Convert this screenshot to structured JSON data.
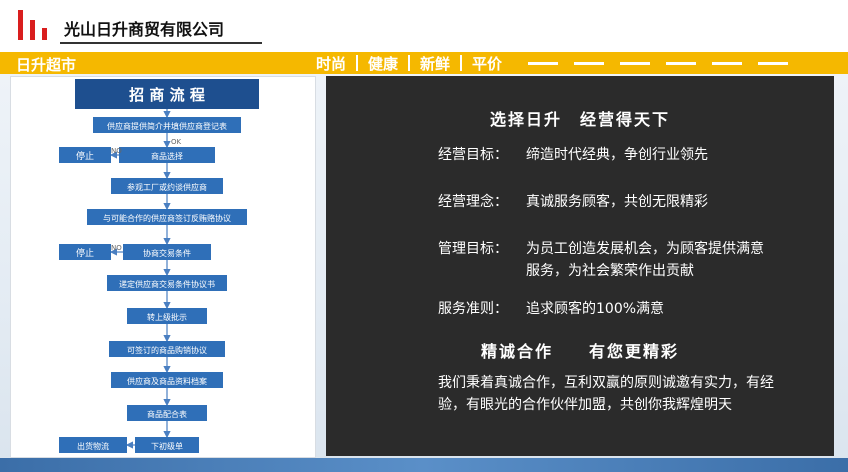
{
  "header": {
    "company": "光山日升商贸有限公司"
  },
  "bar": {
    "title": "日升超市",
    "nav": [
      "时尚",
      "健康",
      "新鲜",
      "平价"
    ]
  },
  "flow": {
    "title": "招 商 流 程",
    "steps": [
      "供应商提供简介并填供应商登记表",
      "商品选择",
      "参观工厂或约谈供应商",
      "与可能合作的供应商签订反贿赂协议",
      "协商交易条件",
      "递定供应商交易条件协议书",
      "转上级批示",
      "可签订的商品购销协议",
      "供应商及商品资料档案",
      "商品配合表",
      "下初级单"
    ],
    "ok_label": "OK",
    "no_label": "NO",
    "stop_label": "停止",
    "ship_label": "出货物流"
  },
  "panel": {
    "heading1": "选择日升　经营得天下",
    "items": [
      {
        "label": "经营目标：",
        "value": "缔造时代经典，争创行业领先"
      },
      {
        "label": "经营理念：",
        "value": "真诚服务顾客，共创无限精彩"
      },
      {
        "label": "管理目标：",
        "value": "为员工创造发展机会，为顾客提供满意服务，为社会繁荣作出贡献"
      },
      {
        "label": "服务准则：",
        "value": "追求顾客的100%满意"
      }
    ],
    "heading2": "精诚合作　　有您更精彩",
    "paragraph": "我们秉着真诚合作，互利双赢的原则诚邀有实力，有经验，有眼光的合作伙伴加盟，共创你我辉煌明天"
  },
  "colors": {
    "accent": "#f5b800",
    "flow_box": "#2f6fb8",
    "title_box": "#1e4f8f",
    "panel_bg": "#2b2b2b"
  }
}
